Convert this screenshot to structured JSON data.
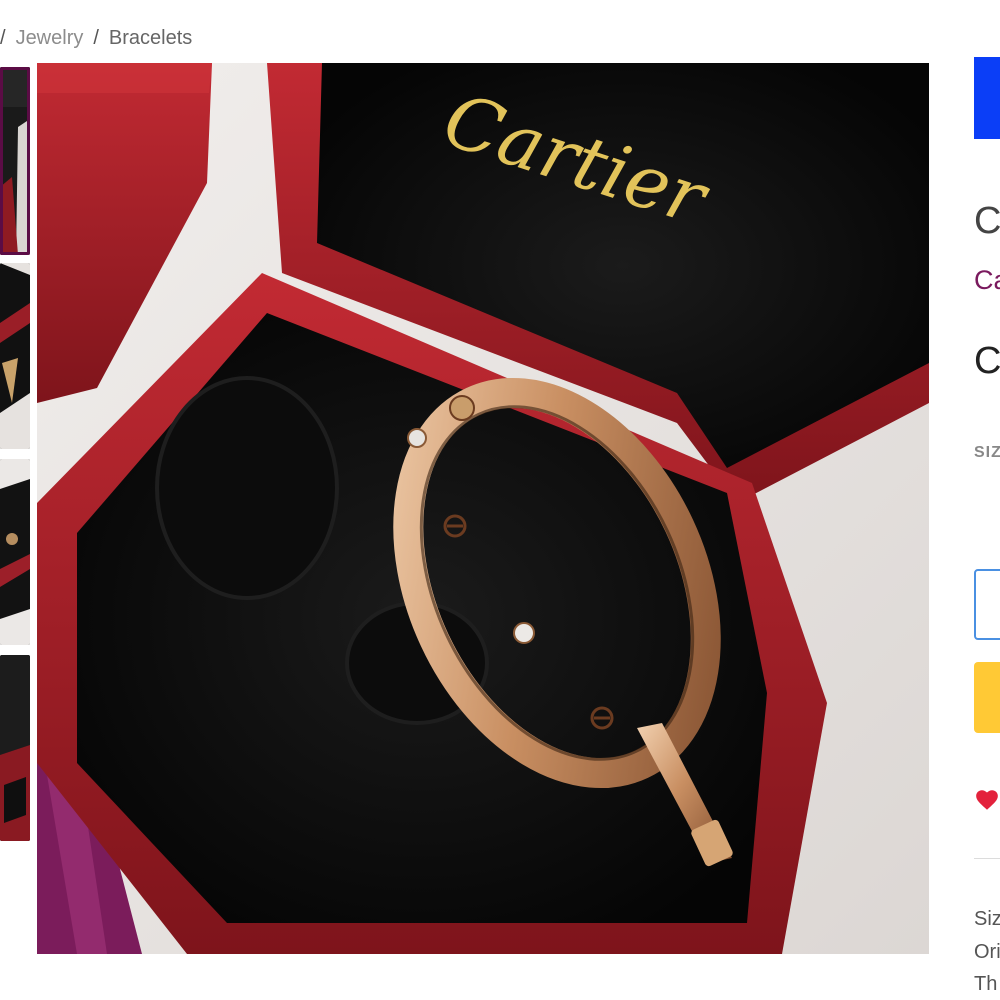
{
  "breadcrumb": {
    "items": [
      {
        "label": "Jewelry"
      },
      {
        "label": "Bracelets"
      }
    ],
    "separator": "/"
  },
  "gallery": {
    "thumbnails": [
      {
        "name": "thumb-1",
        "selected": true
      },
      {
        "name": "thumb-2",
        "selected": false
      },
      {
        "name": "thumb-3",
        "selected": false
      },
      {
        "name": "thumb-4",
        "selected": false
      }
    ],
    "main_image": {
      "box_lid_brand": "Cartier"
    }
  },
  "product": {
    "title_fragment": "C",
    "brand_fragment": "Ca",
    "price_fragment": "C",
    "size_label_fragment": "SIZ",
    "description_fragments": [
      "Siz",
      "Ori",
      "Th"
    ]
  },
  "colors": {
    "primary_button": "#0b3ef7",
    "cart_button": "#ffc935",
    "brand_link": "#7a1a5e",
    "heart": "#e3223c",
    "selected_thumb_border": "#5b0c45"
  },
  "icons": {
    "favorite": "heart-icon"
  }
}
